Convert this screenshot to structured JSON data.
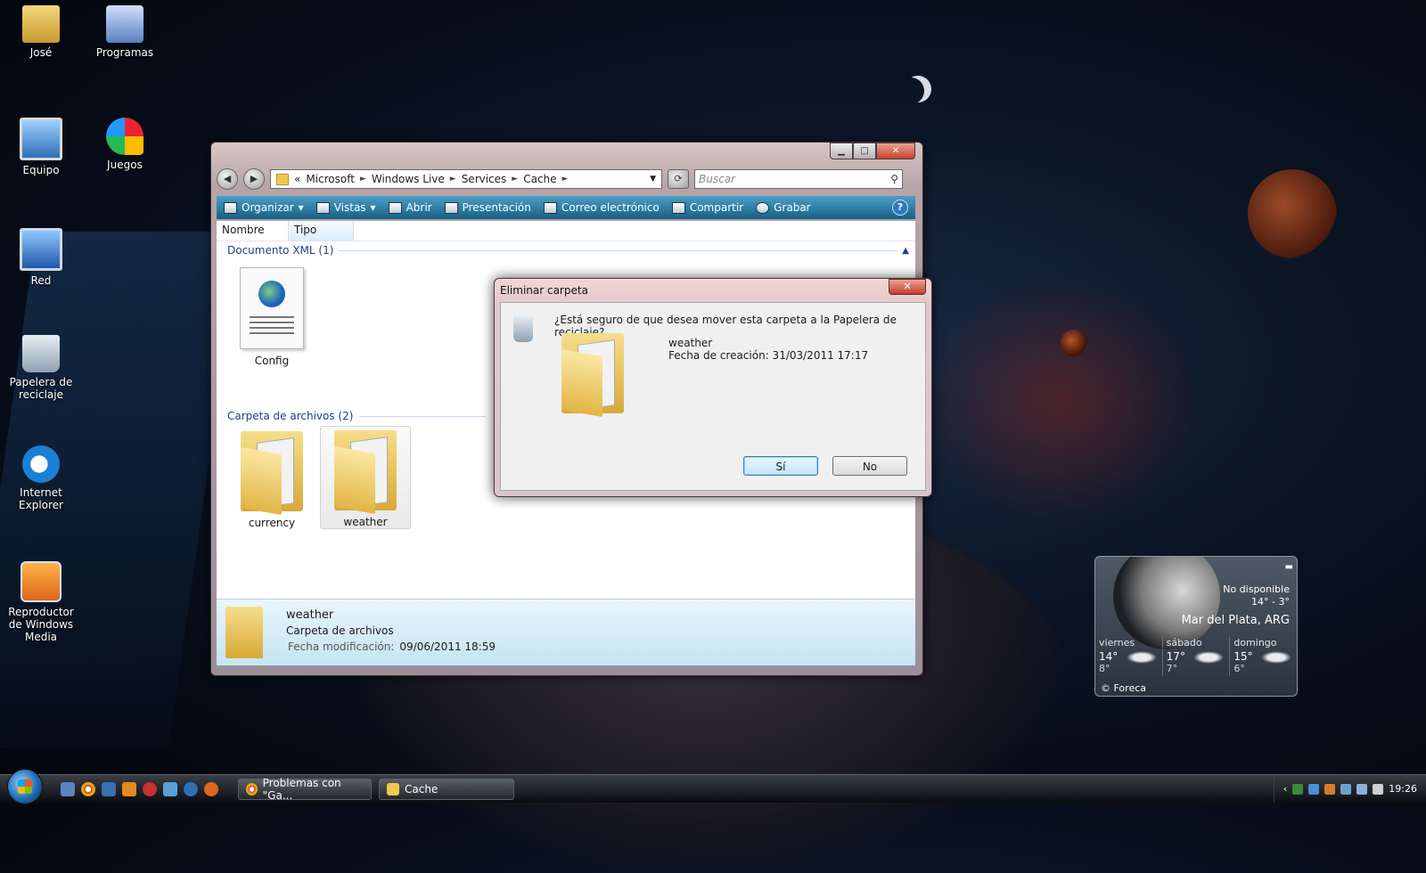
{
  "desktop": {
    "icons": [
      {
        "label": "José",
        "icon": "user-folder-icon"
      },
      {
        "label": "Programas",
        "icon": "programs-icon"
      },
      {
        "label": "Equipo",
        "icon": "computer-icon"
      },
      {
        "label": "Juegos",
        "icon": "games-icon"
      },
      {
        "label": "Red",
        "icon": "network-icon"
      },
      {
        "label": "Papelera de reciclaje",
        "icon": "recycle-bin-icon"
      },
      {
        "label": "Internet Explorer",
        "icon": "internet-explorer-icon"
      },
      {
        "label": "Reproductor de Windows Media",
        "icon": "media-player-icon"
      }
    ]
  },
  "explorer": {
    "controls": {
      "minimize": "▁",
      "maximize": "□",
      "close": "✕"
    },
    "nav": {
      "back": "◀",
      "forward": "▶"
    },
    "address": {
      "overflow": "«",
      "crumbs": [
        "Microsoft",
        "Windows Live",
        "Services",
        "Cache"
      ],
      "sep": "►"
    },
    "search_placeholder": "Buscar",
    "toolbar": {
      "organize": "Organizar",
      "views": "Vistas",
      "open": "Abrir",
      "slideshow": "Presentación",
      "email": "Correo electrónico",
      "share": "Compartir",
      "burn": "Grabar",
      "help": "?"
    },
    "columns": [
      "Nombre",
      "Tipo"
    ],
    "groups": [
      {
        "title": "Documento XML (1)",
        "items": [
          "Config"
        ]
      },
      {
        "title": "Carpeta de archivos (2)",
        "items": [
          "currency",
          "weather"
        ]
      }
    ],
    "details": {
      "name": "weather",
      "kind": "Carpeta de archivos",
      "modified_label": "Fecha modificación:",
      "modified_value": "09/06/2011 18:59"
    }
  },
  "dialog": {
    "title": "Eliminar carpeta",
    "close": "✕",
    "question": "¿Está seguro de que desea mover esta carpeta a la Papelera de reciclaje?",
    "item_name": "weather",
    "item_created": "Fecha de creación: 31/03/2011 17:17",
    "yes": "Sí",
    "no": "No"
  },
  "weather_gadget": {
    "status": "No disponible",
    "range": "14° - 3°",
    "city": "Mar del Plata, ARG",
    "minimize": "▬",
    "days": [
      {
        "name": "viernes",
        "hi": "14°",
        "lo": "8°"
      },
      {
        "name": "sábado",
        "hi": "17°",
        "lo": "7°"
      },
      {
        "name": "domingo",
        "hi": "15°",
        "lo": "6°"
      }
    ],
    "credit": "© Foreca"
  },
  "taskbar": {
    "tasks": [
      {
        "label": "Problemas con \"Ga...",
        "icon": "chrome-icon",
        "color": "#e0a020"
      },
      {
        "label": "Cache",
        "icon": "folder-icon",
        "color": "#f0c850"
      }
    ],
    "tray_chevron": "‹",
    "clock": "19:26"
  },
  "colors": {
    "toolbar": "#1f6e96",
    "group_title": "#1e3f8a"
  }
}
